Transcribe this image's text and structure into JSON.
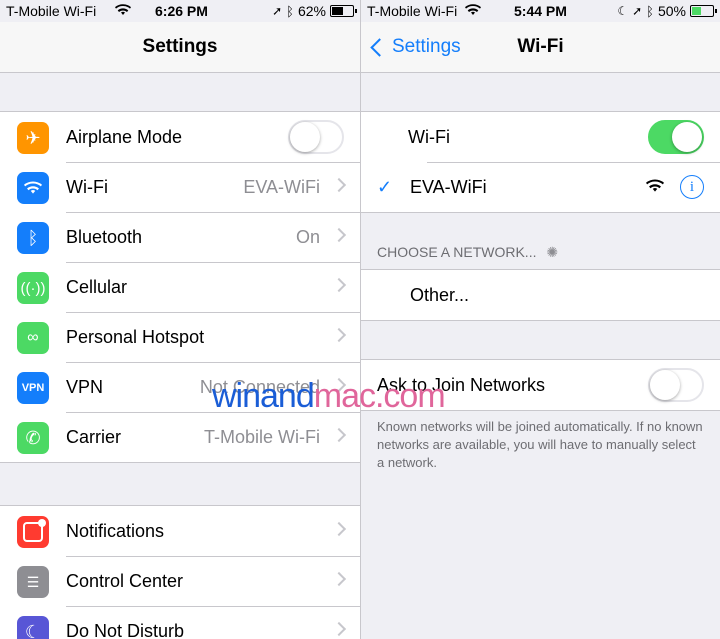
{
  "left": {
    "status": {
      "carrier": "T-Mobile Wi-Fi",
      "time": "6:26 PM",
      "battery": "62%",
      "battery_level": 0.62
    },
    "nav_title": "Settings",
    "group1": [
      {
        "label": "Airplane Mode",
        "detail": "",
        "icon": "airplane-icon",
        "color": "#ff9500",
        "toggle": false
      },
      {
        "label": "Wi-Fi",
        "detail": "EVA-WiFi",
        "icon": "wifi-icon",
        "color": "#147efb"
      },
      {
        "label": "Bluetooth",
        "detail": "On",
        "icon": "bluetooth-icon",
        "color": "#147efb"
      },
      {
        "label": "Cellular",
        "detail": "",
        "icon": "cellular-icon",
        "color": "#4cd964"
      },
      {
        "label": "Personal Hotspot",
        "detail": "",
        "icon": "hotspot-icon",
        "color": "#4cd964"
      },
      {
        "label": "VPN",
        "detail": "Not Connected",
        "icon": "vpn-icon",
        "color": "#147efb",
        "icon_text": "VPN"
      },
      {
        "label": "Carrier",
        "detail": "T-Mobile Wi-Fi",
        "icon": "phone-icon",
        "color": "#4cd964"
      }
    ],
    "group2": [
      {
        "label": "Notifications",
        "icon": "notifications-icon",
        "color": "#ff3b30"
      },
      {
        "label": "Control Center",
        "icon": "control-center-icon",
        "color": "#8e8e93"
      },
      {
        "label": "Do Not Disturb",
        "icon": "moon-icon",
        "color": "#5856d6"
      }
    ]
  },
  "right": {
    "status": {
      "carrier": "T-Mobile Wi-Fi",
      "time": "5:44 PM",
      "battery": "50%",
      "battery_level": 0.5
    },
    "back_label": "Settings",
    "nav_title": "Wi-Fi",
    "wifi_label": "Wi-Fi",
    "wifi_on": true,
    "network_name": "EVA-WiFi",
    "choose_header": "CHOOSE A NETWORK...",
    "other_label": "Other...",
    "ask_label": "Ask to Join Networks",
    "ask_on": false,
    "footer": "Known networks will be joined automatically. If no known networks are available, you will have to manually select a network."
  },
  "watermark": {
    "part1": "winand",
    "part2": "mac.com"
  }
}
